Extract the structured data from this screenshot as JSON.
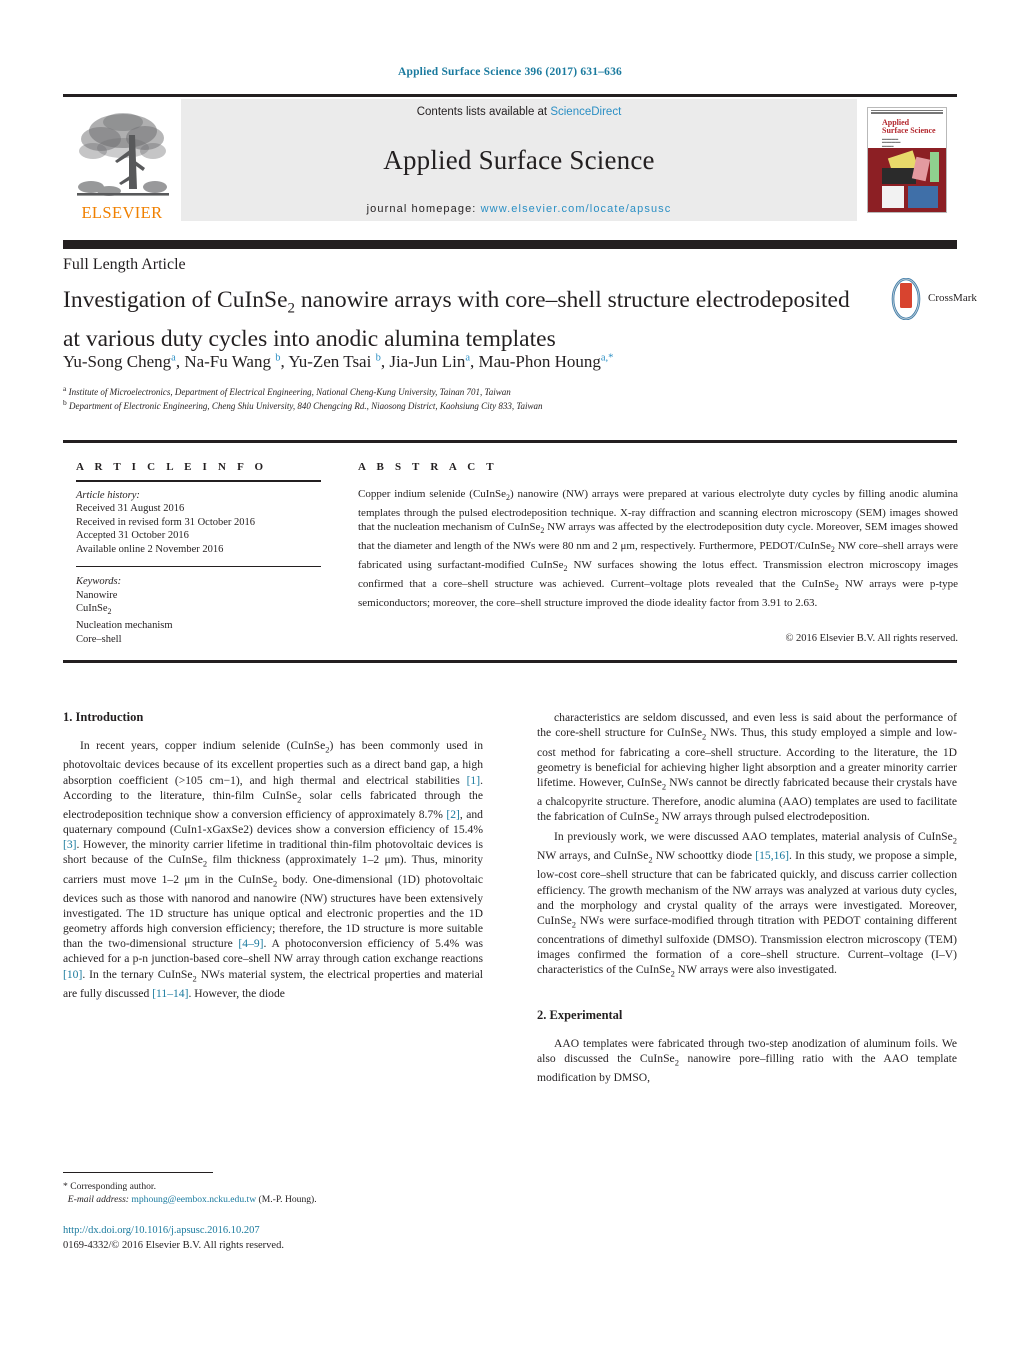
{
  "running_head": "Applied Surface Science 396 (2017) 631–636",
  "masthead": {
    "contents_prefix": "Contents lists available at ",
    "contents_link": "ScienceDirect",
    "journal_name": "Applied Surface Science",
    "homepage_label": "journal homepage: ",
    "homepage_url": "www.elsevier.com/locate/apsusc",
    "publisher_logo_text": "ELSEVIER",
    "cover_title_line1": "Applied",
    "cover_title_line2": "Surface Science"
  },
  "article": {
    "type": "Full Length Article",
    "title_line1": "Investigation of CuInSe",
    "title_sub1": "2",
    "title_line1b": " nanowire arrays with core–shell structure",
    "title_line2": "electrodeposited at various duty cycles into anodic alumina templates",
    "crossmark_label": "CrossMark",
    "authors": "Yu-Song Cheng a, Na-Fu Wang b, Yu-Zen Tsai b, Jia-Jun Lin a, Mau-Phon Houng a,*",
    "affiliation_a": "a Institute of Microelectronics, Department of Electrical Engineering, National Cheng-Kung University, Tainan 701, Taiwan",
    "affiliation_b": "b Department of Electronic Engineering, Cheng Shiu University, 840 Chengcing Rd., Niaosong District, Kaohsiung City 833, Taiwan"
  },
  "info": {
    "heading": "A R T I C L E    I N F O",
    "history_label": "Article history:",
    "history": [
      "Received 31 August 2016",
      "Received in revised form 31 October 2016",
      "Accepted 31 October 2016",
      "Available online 2 November 2016"
    ],
    "keywords_label": "Keywords:",
    "keywords": [
      "Nanowire",
      "CuInSe2",
      "Nucleation mechanism",
      "Core–shell"
    ]
  },
  "abstract": {
    "heading": "A B S T R A C T",
    "text": "Copper indium selenide (CuInSe2) nanowire (NW) arrays were prepared at various electrolyte duty cycles by filling anodic alumina templates through the pulsed electrodeposition technique. X-ray diffraction and scanning electron microscopy (SEM) images showed that the nucleation mechanism of CuInSe2 NW arrays was affected by the electrodeposition duty cycle. Moreover, SEM images showed that the diameter and length of the NWs were 80 nm and 2 μm, respectively. Furthermore, PEDOT/CuInSe2 NW core–shell arrays were fabricated using surfactant-modified CuInSe2 NW surfaces showing the lotus effect. Transmission electron microscopy images confirmed that a core–shell structure was achieved. Current–voltage plots revealed that the CuInSe2 NW arrays were p-type semiconductors; moreover, the core–shell structure improved the diode ideality factor from 3.91 to 2.63.",
    "copyright": "© 2016 Elsevier B.V. All rights reserved."
  },
  "body": {
    "section1_heading": "1. Introduction",
    "section1_p1": "In recent years, copper indium selenide (CuInSe2) has been commonly used in photovoltaic devices because of its excellent properties such as a direct band gap, a high absorption coefficient (>105 cm−1), and high thermal and electrical stabilities [1]. According to the literature, thin-film CuInSe2 solar cells fabricated through the electrodeposition technique show a conversion efficiency of approximately 8.7% [2], and quaternary compound (CuIn1-xGaxSe2) devices show a conversion efficiency of 15.4% [3]. However, the minority carrier lifetime in traditional thin-film photovoltaic devices is short because of the CuInSe2 film thickness (approximately 1–2 μm). Thus, minority carriers must move 1–2 μm in the CuInSe2 body. One-dimensional (1D) photovoltaic devices such as those with nanorod and nanowire (NW) structures have been extensively investigated. The 1D structure has unique optical and electronic properties and the 1D geometry affords high conversion efficiency; therefore, the 1D structure is more suitable than the two-dimensional structure [4–9]. A photoconversion efficiency of 5.4% was achieved for a p-n junction-based core–shell NW array through cation exchange reactions [10]. In the ternary CuInSe2 NWs material system, the electrical properties and material are fully discussed [11–14]. However, the diode",
    "section1_p2": "characteristics are seldom discussed, and even less is said about the performance of the core-shell structure for CuInSe2 NWs. Thus, this study employed a simple and low-cost method for fabricating a core–shell structure. According to the literature, the 1D geometry is beneficial for achieving higher light absorption and a greater minority carrier lifetime. However, CuInSe2 NWs cannot be directly fabricated because their crystals have a chalcopyrite structure. Therefore, anodic alumina (AAO) templates are used to facilitate the fabrication of CuInSe2 NW arrays through pulsed electrodeposition.",
    "section1_p3": "In previously work, we were discussed AAO templates, material analysis of CuInSe2 NW arrays, and CuInSe2 NW schoottky diode [15,16]. In this study, we propose a simple, low-cost core–shell structure that can be fabricated quickly, and discuss carrier collection efficiency. The growth mechanism of the NW arrays was analyzed at various duty cycles, and the morphology and crystal quality of the arrays were investigated. Moreover, CuInSe2 NWs were surface-modified through titration with PEDOT containing different concentrations of dimethyl sulfoxide (DMSO). Transmission electron microscopy (TEM) images confirmed the formation of a core–shell structure. Current–voltage (I–V) characteristics of the CuInSe2 NW arrays were also investigated.",
    "section2_heading": "2. Experimental",
    "section2_p1": "AAO templates were fabricated through two-step anodization of aluminum foils. We also discussed the CuInSe2 nanowire pore–filling ratio with the AAO template modification by DMSO,"
  },
  "footer": {
    "corresponding_marker": "*",
    "corresponding_label": " Corresponding author.",
    "email_label": "E-mail address:",
    "email": "mphoung@eembox.ncku.edu.tw",
    "email_suffix": " (M.-P. Houng).",
    "doi": "http://dx.doi.org/10.1016/j.apsusc.2016.10.207",
    "issn_line": "0169-4332/© 2016 Elsevier B.V. All rights reserved."
  },
  "colors": {
    "link": "#1a7a9e",
    "sciencedirect": "#2b8fc4",
    "elsevier_orange": "#f08000",
    "cover_red": "#8c1f24",
    "ink": "#231f20"
  }
}
